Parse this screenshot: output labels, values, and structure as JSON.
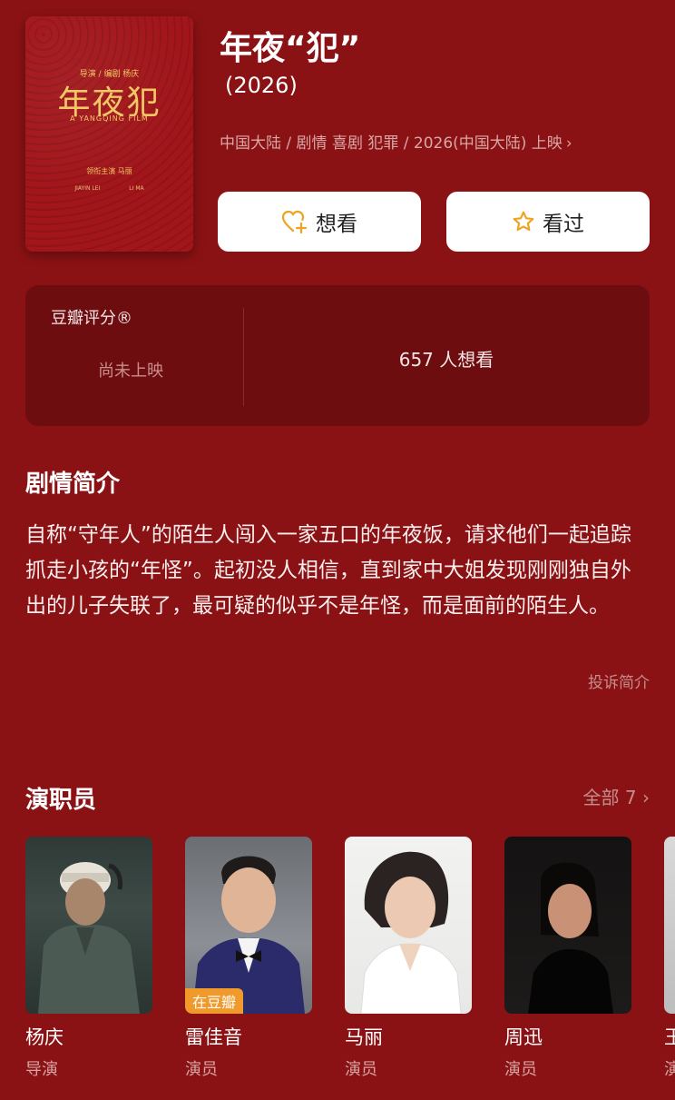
{
  "movie": {
    "title": "年夜“犯”",
    "year": "(2026)",
    "meta": "中国大陆 / 剧情 喜剧 犯罪 / 2026(中国大陆) 上映",
    "poster": {
      "title": "年夜犯",
      "credit_top": "导演 / 编剧  杨庆",
      "subtitle": "A YANGQING FILM",
      "cast_line": "领衔主演          马丽",
      "names": [
        "JIAYIN LEI",
        "LI MA"
      ]
    }
  },
  "actions": {
    "want_label": "想看",
    "seen_label": "看过"
  },
  "rating": {
    "label": "豆瓣评分®",
    "status": "尚未上映",
    "want_count": "657 人想看"
  },
  "synopsis": {
    "title": "剧情简介",
    "text": "自称“守年人”的陌生人闯入一家五口的年夜饭，请求他们一起追踪抓走小孩的“年怪”。起初没人相信，直到家中大姐发现刚刚独自外出的儿子失联了，最可疑的似乎不是年怪，而是面前的陌生人。",
    "report_label": "投诉简介"
  },
  "cast": {
    "title": "演职员",
    "all_label": "全部 7",
    "items": [
      {
        "name": "杨庆",
        "role": "导演",
        "badge": ""
      },
      {
        "name": "雷佳音",
        "role": "演员",
        "badge": "在豆瓣"
      },
      {
        "name": "马丽",
        "role": "演员",
        "badge": ""
      },
      {
        "name": "周迅",
        "role": "演员",
        "badge": ""
      },
      {
        "name": "王",
        "role": "演",
        "badge": ""
      }
    ]
  },
  "colors": {
    "background": "#8b1214",
    "panel": "#6e0d10",
    "accent": "#f0a31f"
  }
}
